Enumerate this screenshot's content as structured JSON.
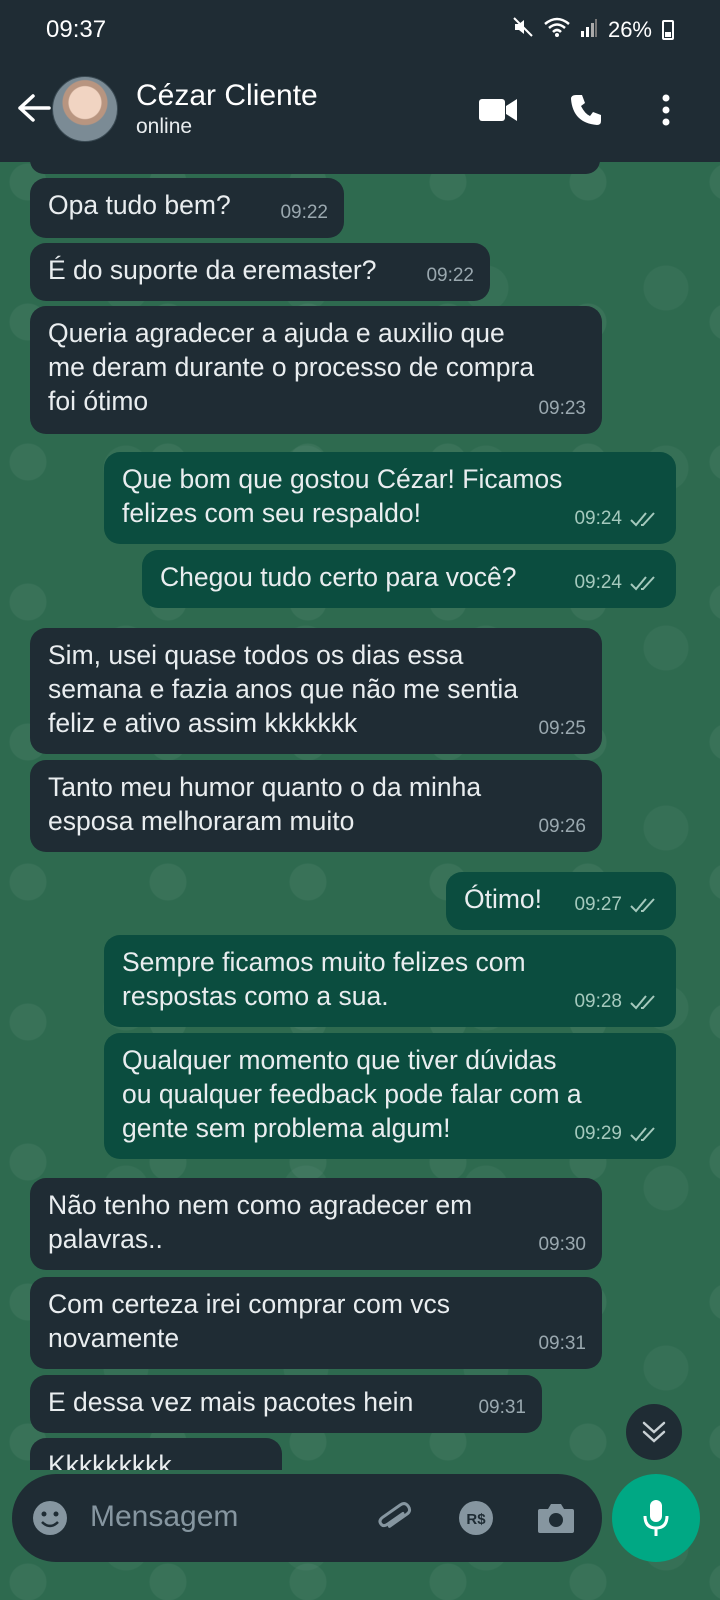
{
  "status_bar": {
    "time": "09:37",
    "battery": "26%"
  },
  "header": {
    "contact_name": "Cézar Cliente",
    "contact_status": "online"
  },
  "messages": [
    {
      "dir": "in",
      "text": "Opa tudo bem?",
      "time": "09:22"
    },
    {
      "dir": "in",
      "text": "É do suporte da eremaster?",
      "time": "09:22"
    },
    {
      "dir": "in",
      "text": "Queria agradecer a ajuda e auxilio que\nme deram durante o processo de compra\nfoi ótimo",
      "time": "09:23"
    },
    {
      "dir": "out",
      "text": "Que bom que gostou Cézar! Ficamos\nfelizes com seu respaldo!",
      "time": "09:24"
    },
    {
      "dir": "out",
      "text": "Chegou tudo certo para você?",
      "time": "09:24"
    },
    {
      "dir": "in",
      "text": "Sim, usei quase todos os dias essa\nsemana e fazia anos que não me sentia\nfeliz e ativo assim kkkkkkk",
      "time": "09:25"
    },
    {
      "dir": "in",
      "text": "Tanto meu humor quanto o da minha\nesposa melhoraram muito",
      "time": "09:26"
    },
    {
      "dir": "out",
      "text": "Ótimo!",
      "time": "09:27"
    },
    {
      "dir": "out",
      "text": "Sempre ficamos muito felizes com\nrespostas como a sua.",
      "time": "09:28"
    },
    {
      "dir": "out",
      "text": "Qualquer momento que tiver dúvidas\nou qualquer feedback pode falar com a\ngente sem problema algum!",
      "time": "09:29"
    },
    {
      "dir": "in",
      "text": "Não tenho nem como agradecer em\npalavras..",
      "time": "09:30"
    },
    {
      "dir": "in",
      "text": "Com certeza irei comprar com vcs\nnovamente",
      "time": "09:31"
    },
    {
      "dir": "in",
      "text": "E dessa vez mais pacotes hein",
      "time": "09:31"
    }
  ],
  "partial_message": {
    "text": "Kkkkkkkkk"
  },
  "composer": {
    "placeholder": "Mensagem"
  },
  "icons": [
    "back-arrow-icon",
    "video-call-icon",
    "phone-icon",
    "more-options-icon",
    "emoji-icon",
    "attach-icon",
    "payment-icon",
    "camera-icon",
    "mic-icon",
    "scroll-down-icon",
    "double-check-icon",
    "mute-icon",
    "wifi-icon",
    "signal-icon",
    "battery-icon"
  ],
  "colors": {
    "header_bg": "#1f2c34",
    "incoming_bubble": "#1f2c34",
    "outgoing_bubble": "#0b4d3f",
    "accent": "#00a884",
    "wallpaper": "#2e6a4f"
  }
}
